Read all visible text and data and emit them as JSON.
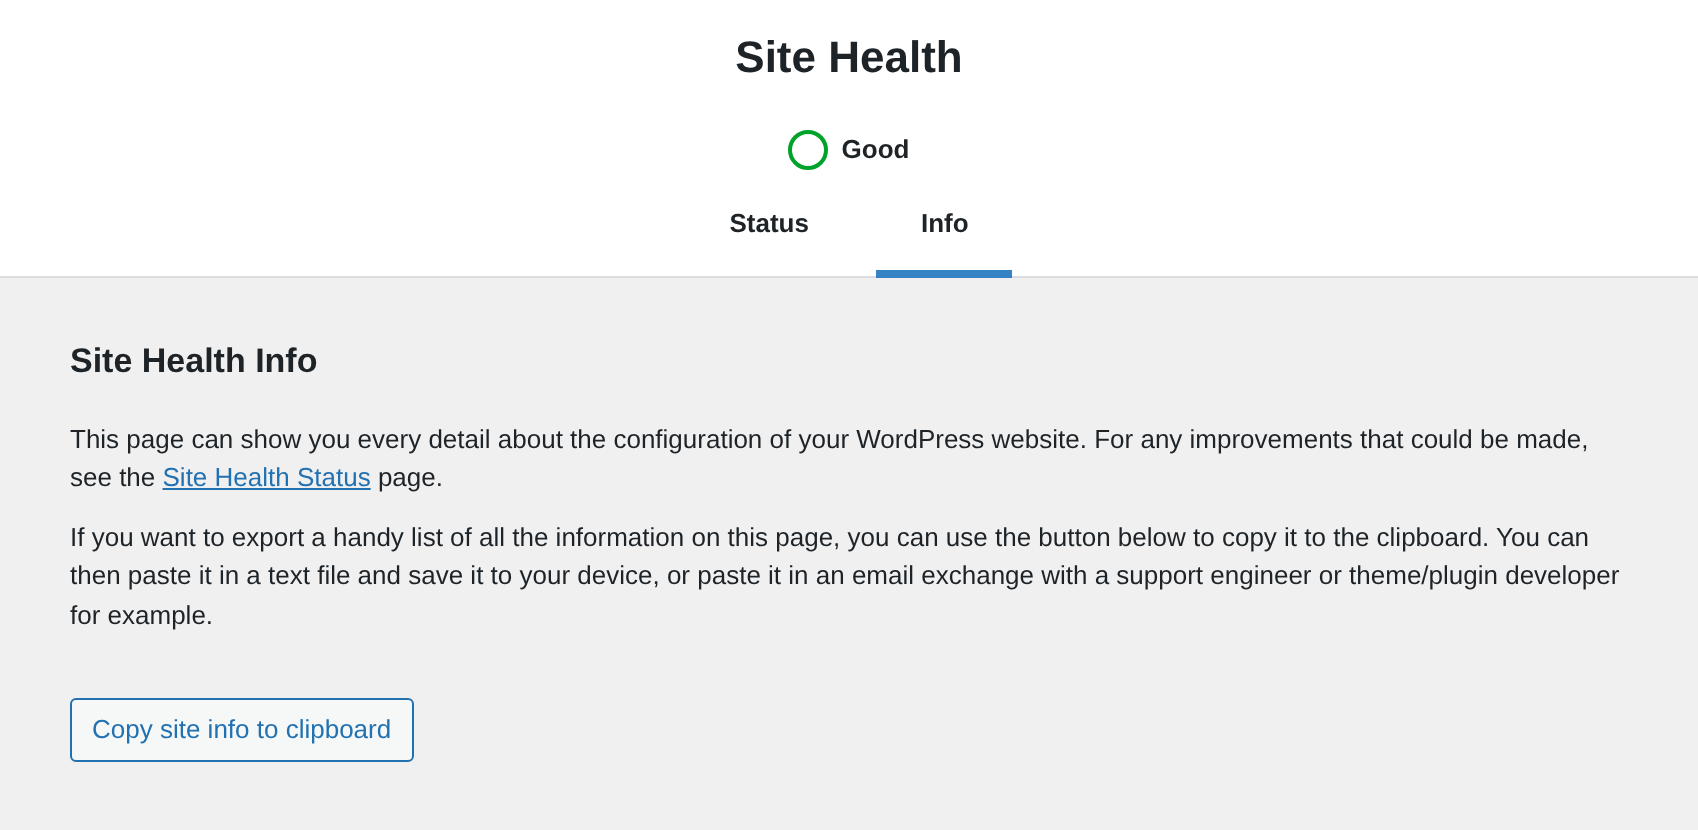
{
  "header": {
    "title": "Site Health",
    "status": {
      "label": "Good",
      "color": "#00a32a"
    }
  },
  "tabs": [
    {
      "label": "Status",
      "selected": false
    },
    {
      "label": "Info",
      "selected": true
    }
  ],
  "section": {
    "heading": "Site Health Info",
    "intro": {
      "before": "This page can show you every detail about the configuration of your WordPress website. For any improvements that could be made, see the ",
      "link": "Site Health Status",
      "after": " page."
    },
    "paragraph": "If you want to export a handy list of all the information on this page, you can use the button below to copy it to the clipboard. You can then paste it in a text file and save it to your device, or paste it in an email exchange with a support engineer or theme/plugin developer for example.",
    "button": "Copy site info to clipboard"
  }
}
